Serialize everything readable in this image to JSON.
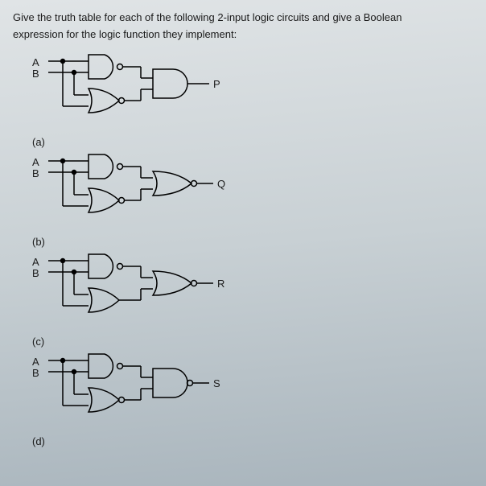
{
  "question": {
    "line1": "Give the truth table for each of the following 2-input logic circuits and give a Boolean",
    "line2": "expression for the logic function they implement:"
  },
  "circuits": [
    {
      "id": "a",
      "label": "(a)",
      "inputA": "A",
      "inputB": "B",
      "output": "P"
    },
    {
      "id": "b",
      "label": "(b)",
      "inputA": "A",
      "inputB": "B",
      "output": "Q"
    },
    {
      "id": "c",
      "label": "(c)",
      "inputA": "A",
      "inputB": "B",
      "output": "R"
    },
    {
      "id": "d",
      "label": "(d)",
      "inputA": "A",
      "inputB": "B",
      "output": "S"
    }
  ]
}
